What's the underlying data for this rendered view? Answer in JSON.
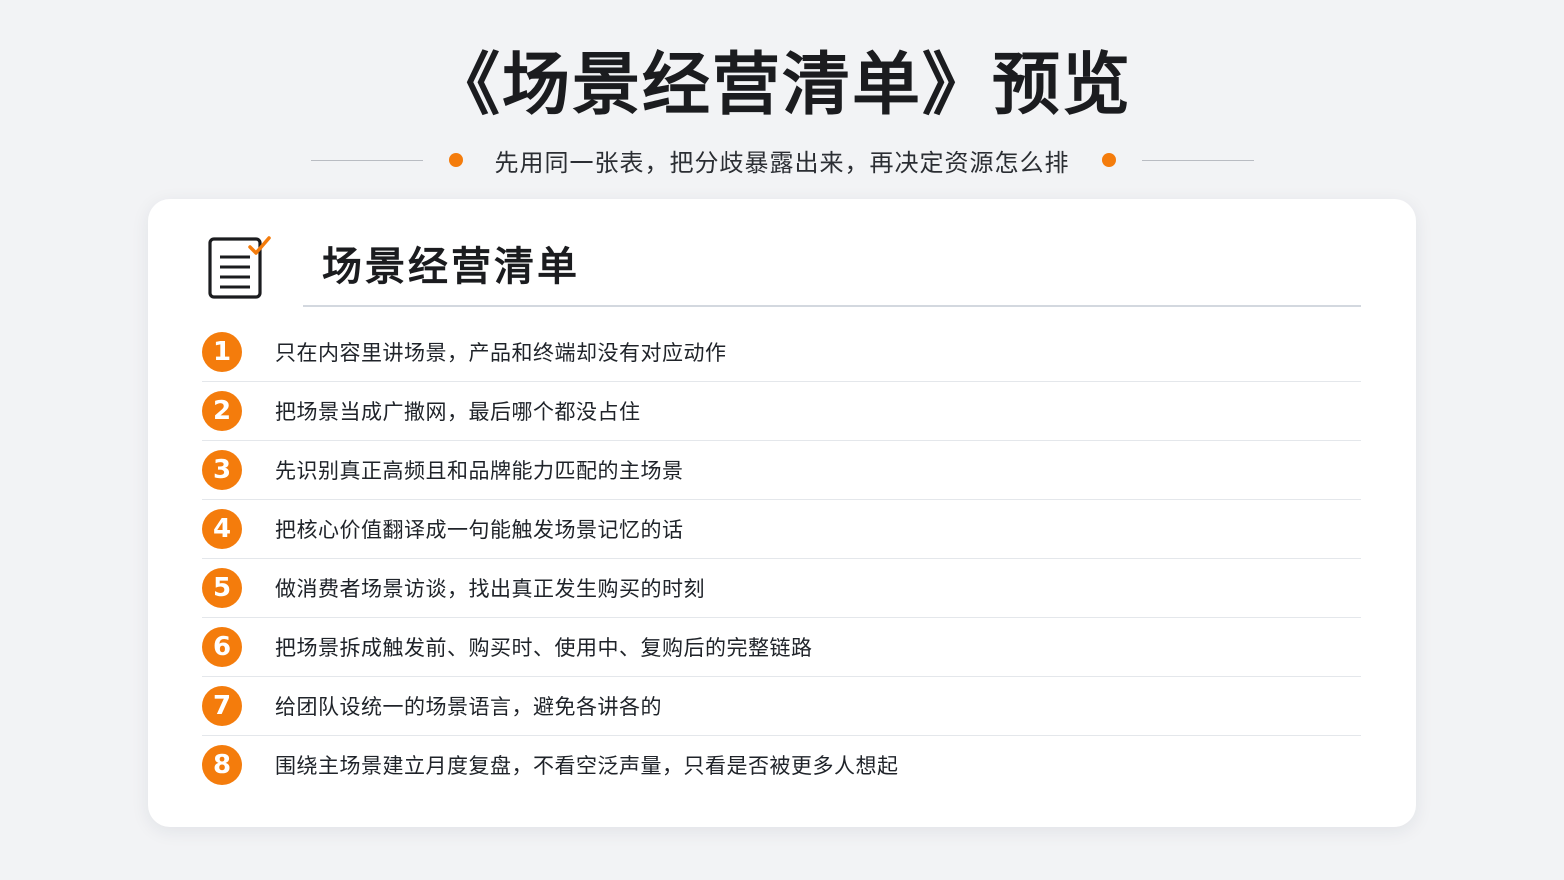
{
  "page": {
    "title": "《场景经营清单》预览",
    "subtitle": "先用同一张表，把分歧暴露出来，再决定资源怎么排"
  },
  "card": {
    "title": "场景经营清单",
    "icon": "checklist-icon",
    "items": [
      {
        "num": "1",
        "text": "只在内容里讲场景，产品和终端却没有对应动作"
      },
      {
        "num": "2",
        "text": "把场景当成广撒网，最后哪个都没占住"
      },
      {
        "num": "3",
        "text": "先识别真正高频且和品牌能力匹配的主场景"
      },
      {
        "num": "4",
        "text": "把核心价值翻译成一句能触发场景记忆的话"
      },
      {
        "num": "5",
        "text": "做消费者场景访谈，找出真正发生购买的时刻"
      },
      {
        "num": "6",
        "text": "把场景拆成触发前、购买时、使用中、复购后的完整链路"
      },
      {
        "num": "7",
        "text": "给团队设统一的场景语言，避免各讲各的"
      },
      {
        "num": "8",
        "text": "围绕主场景建立月度复盘，不看空泛声量，只看是否被更多人想起"
      }
    ]
  },
  "colors": {
    "accent": "#f47c0c",
    "background": "#f2f3f5",
    "card": "#ffffff",
    "text": "#1f2329",
    "divider": "#e4e7eb"
  }
}
